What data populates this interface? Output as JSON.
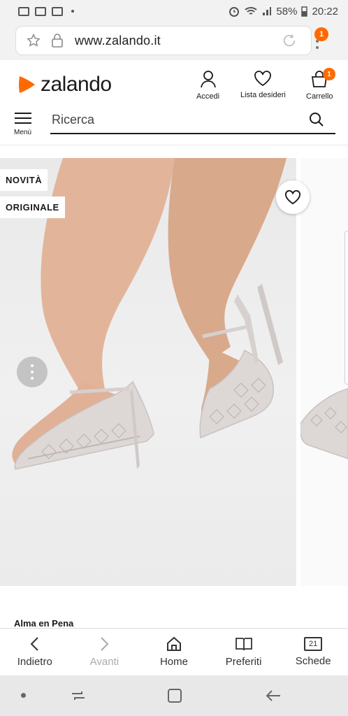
{
  "status_bar": {
    "battery": "58%",
    "time": "20:22"
  },
  "browser": {
    "url": "www.zalando.it",
    "menu_badge_count": "1"
  },
  "header": {
    "logo_text": "zalando",
    "account_label": "Accedi",
    "wishlist_label": "Lista desideri",
    "cart_label": "Carrello",
    "cart_count": "1",
    "menu_label": "Menù",
    "search_placeholder": "Ricerca"
  },
  "product": {
    "tags": [
      "NOVITÀ",
      "ORIGINALE"
    ],
    "brand": "Alma en Pena"
  },
  "bottom_nav": {
    "back": "Indietro",
    "forward": "Avanti",
    "home": "Home",
    "bookmarks": "Preferiti",
    "tabs": "Schede",
    "tabs_count": "21"
  },
  "colors": {
    "brand_orange": "#ff6900",
    "text_dark": "#1a1a1a"
  }
}
